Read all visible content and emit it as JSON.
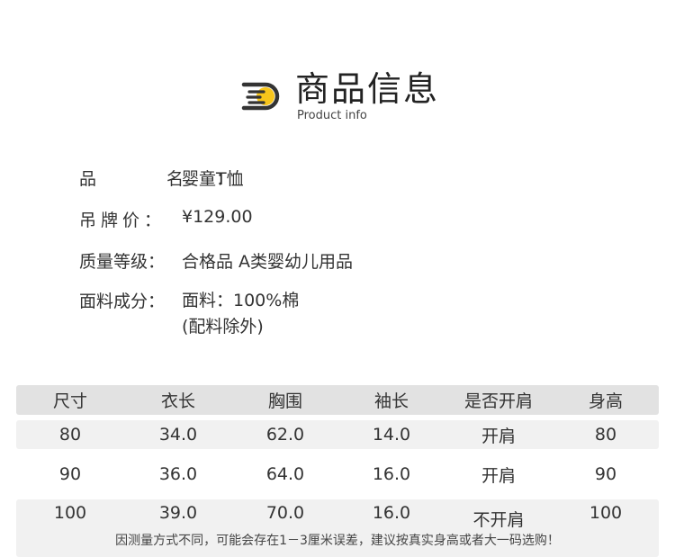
{
  "header": {
    "icon": "document-lines-icon",
    "accent_color": "#f7c51b",
    "title": "商品信息",
    "subtitle": "Product info"
  },
  "info": [
    {
      "label": "品 名：",
      "value": "婴童T恤"
    },
    {
      "label": "吊牌价：",
      "value": "¥129.00"
    },
    {
      "label": "质量等级：",
      "value": "合格品 A类婴幼儿用品"
    },
    {
      "label": "面料成分：",
      "value": "面料：100%棉",
      "value2": "(配料除外)"
    }
  ],
  "size_table": {
    "headers": [
      "尺寸",
      "衣长",
      "胸围",
      "袖长",
      "是否开肩",
      "身高"
    ],
    "rows": [
      [
        "80",
        "34.0",
        "62.0",
        "14.0",
        "开肩",
        "80"
      ],
      [
        "90",
        "36.0",
        "64.0",
        "16.0",
        "开肩",
        "90"
      ],
      [
        "100",
        "39.0",
        "70.0",
        "16.0",
        "不开肩",
        "100"
      ]
    ]
  },
  "note": "因测量方式不同，可能会存在1－3厘米误差，建议按真实身高或者大一码选购！"
}
